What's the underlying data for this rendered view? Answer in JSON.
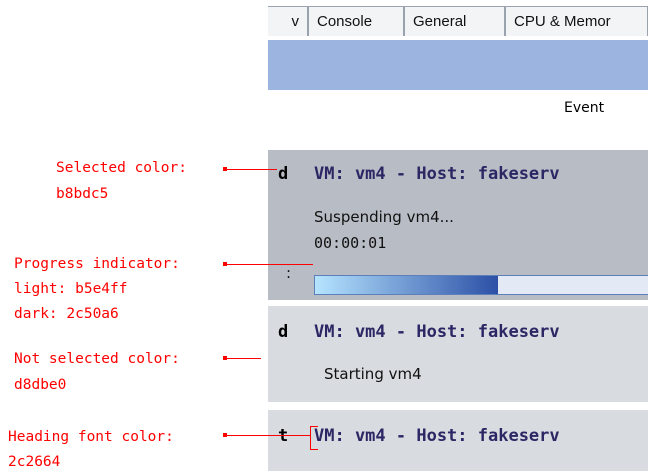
{
  "tabs": [
    {
      "label": "v"
    },
    {
      "label": "Console"
    },
    {
      "label": "General"
    },
    {
      "label": "CPU & Memor"
    }
  ],
  "events_label": "Event",
  "colors": {
    "selected": "#b8bdc5",
    "not_selected": "#d8dbe0",
    "progress_light": "#b5e4ff",
    "progress_dark": "#2c50a6",
    "heading_font": "#2c2664",
    "annotation": "#ff0000"
  },
  "panels": [
    {
      "state": "selected",
      "stub": "d",
      "heading": "VM: vm4 - Host: fakeserv",
      "text": "Suspending vm4...",
      "elapsed": "00:00:01",
      "progress_stub": ":",
      "progress_fraction": 0.55
    },
    {
      "state": "not selected",
      "stub": "d",
      "heading": "VM: vm4 - Host: fakeserv",
      "text": "Starting vm4"
    },
    {
      "state": "not selected",
      "stub": "t",
      "heading": "VM: vm4 - Host: fakeserv"
    }
  ],
  "annotations": {
    "selected_title": "Selected color:",
    "selected_value": "b8bdc5",
    "progress_title": "Progress indicator:",
    "progress_light": "light: b5e4ff",
    "progress_dark": "dark: 2c50a6",
    "not_selected_title": "Not selected color:",
    "not_selected_value": "d8dbe0",
    "heading_font_title": "Heading font color:",
    "heading_font_value": "2c2664"
  }
}
